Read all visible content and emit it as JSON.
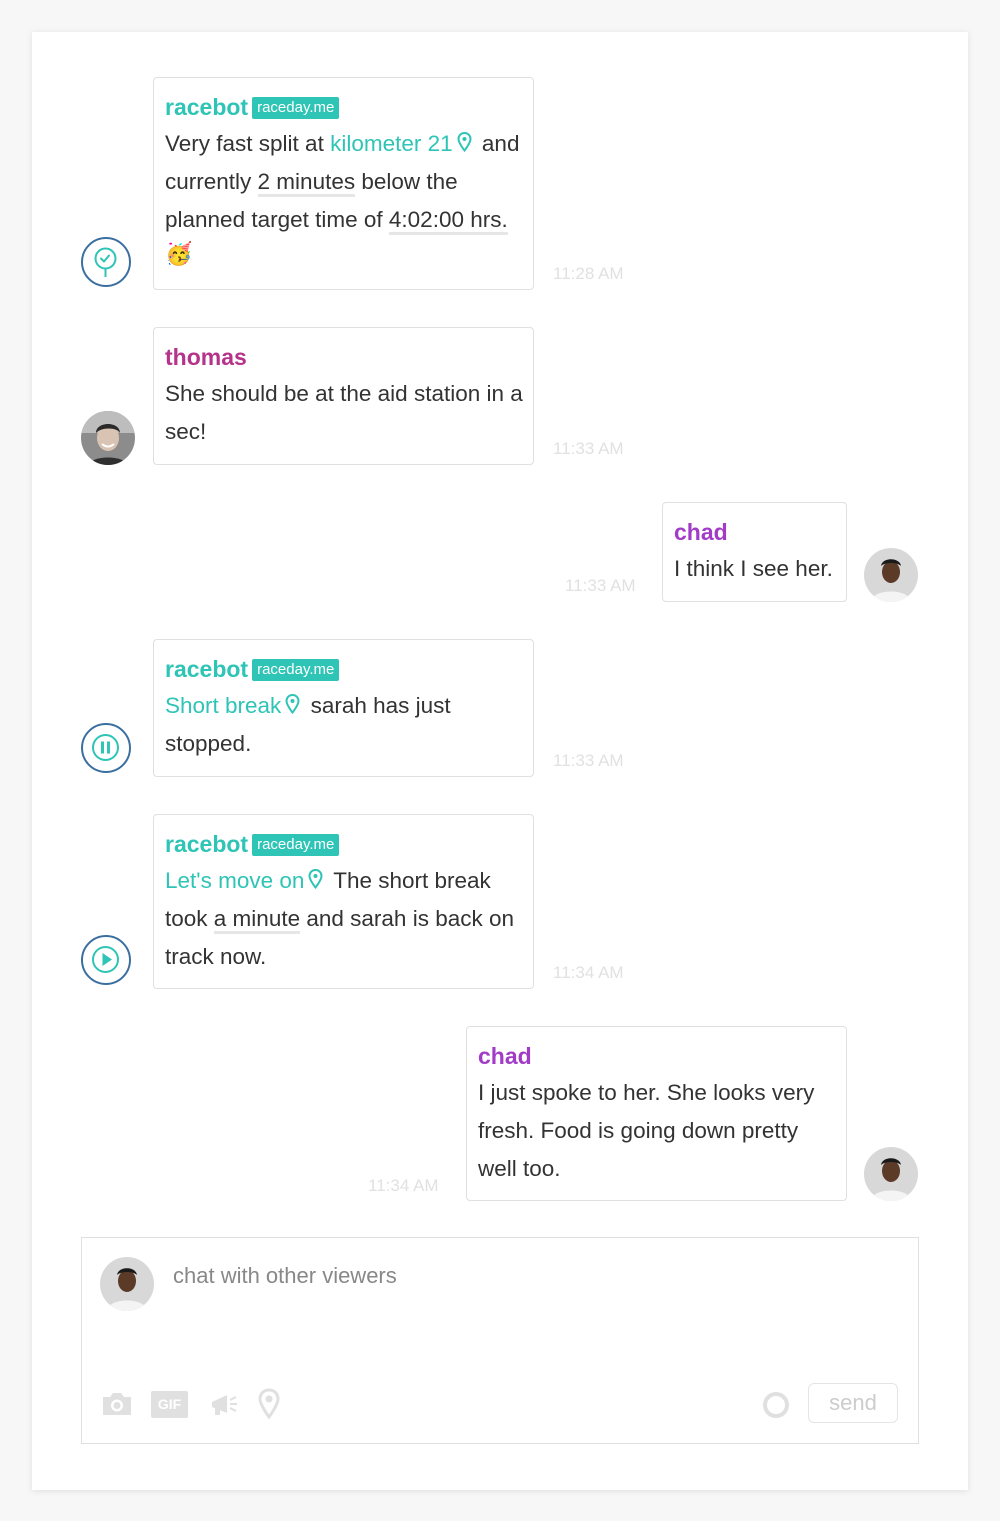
{
  "messages": [
    {
      "author": "racebot",
      "badge": "raceday.me",
      "parts": [
        "Very fast split at",
        "kilometer 21",
        "and currently",
        "2 minutes",
        "below the planned target time of",
        "4:02:00 hrs."
      ],
      "emoji": "🥳",
      "time": "11:28 AM",
      "status_icon": "pin-check-icon"
    },
    {
      "author": "thomas",
      "text": "She should be at the aid station in a sec!",
      "time": "11:33 AM"
    },
    {
      "author": "chad",
      "text": "I think I see her.",
      "time": "11:33 AM"
    },
    {
      "author": "racebot",
      "badge": "raceday.me",
      "parts": [
        "Short break",
        "sarah has just stopped."
      ],
      "time": "11:33 AM",
      "status_icon": "pause-icon"
    },
    {
      "author": "racebot",
      "badge": "raceday.me",
      "parts": [
        "Let's move on",
        "The short break took",
        "a minute",
        "and sarah is back on track now."
      ],
      "time": "11:34 AM",
      "status_icon": "play-icon"
    },
    {
      "author": "chad",
      "text": "I just spoke to her. She looks very fresh. Food is going down pretty well too.",
      "time": "11:34 AM"
    }
  ],
  "composer": {
    "placeholder": "chat with other viewers",
    "send_label": "send",
    "gif_label": "GIF",
    "tools": [
      "camera-icon",
      "gif-icon",
      "megaphone-icon",
      "location-pin-icon",
      "record-icon"
    ]
  },
  "colors": {
    "accent": "#2ec4b6",
    "thomas": "#b5338a",
    "chad": "#a23cc7",
    "status_ring": "#3b6fa0"
  }
}
